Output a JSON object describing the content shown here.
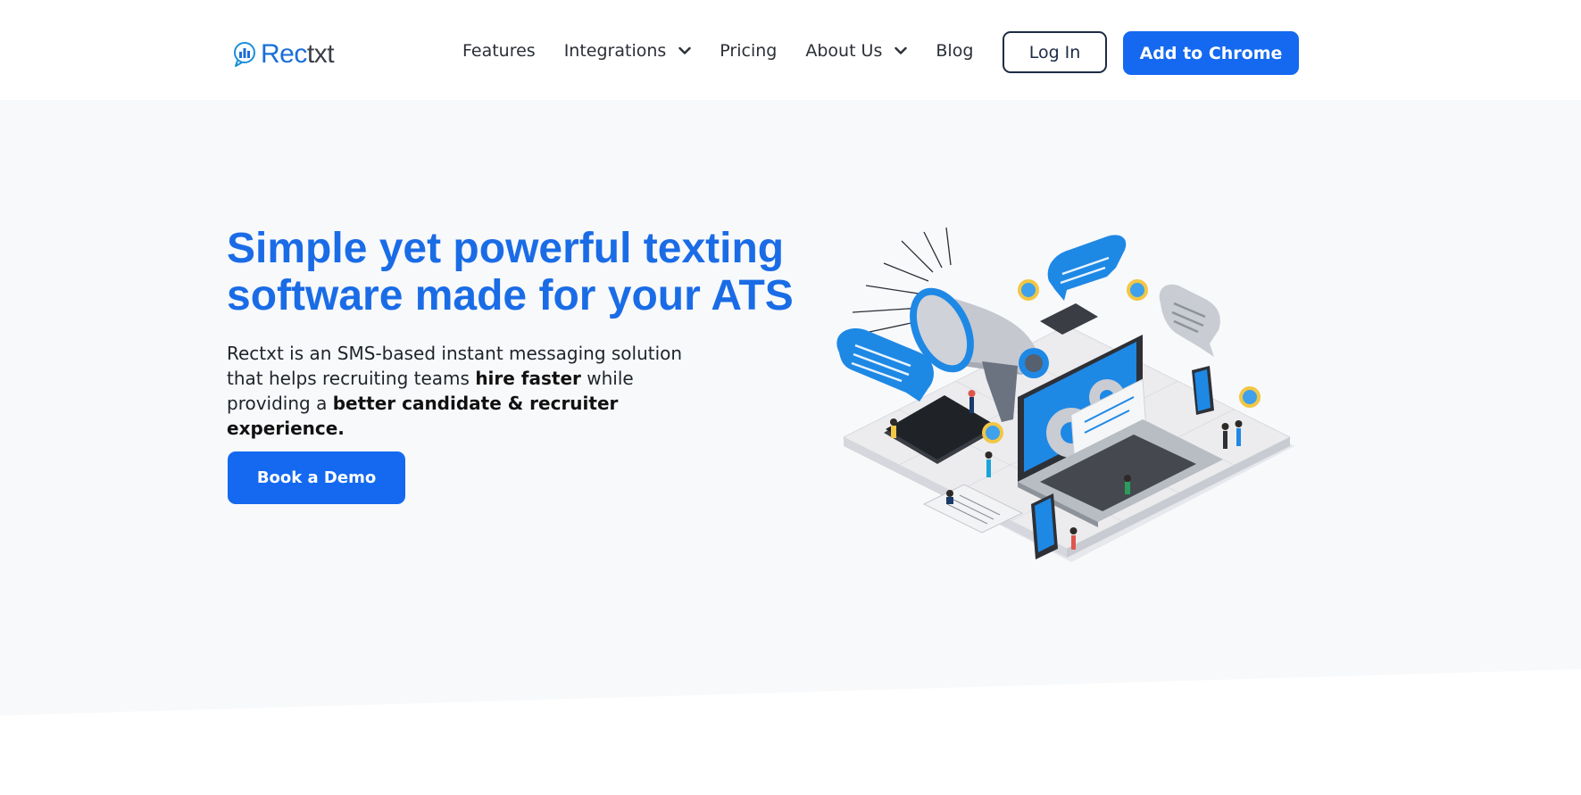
{
  "nav": {
    "logo": {
      "rec": "Rec",
      "txt": "txt"
    },
    "menu": [
      {
        "label": "Features",
        "dropdown": false
      },
      {
        "label": "Integrations",
        "dropdown": true
      },
      {
        "label": "Pricing",
        "dropdown": false
      },
      {
        "label": "About Us",
        "dropdown": true
      },
      {
        "label": "Blog",
        "dropdown": false
      }
    ],
    "login_label": "Log In",
    "chrome_label": "Add to Chrome"
  },
  "hero": {
    "title_line1": "Simple yet powerful texting",
    "title_line2": "software made for your ATS",
    "desc": {
      "part1": "Rectxt is an SMS-based instant messaging solution that helps recruiting teams ",
      "bold1": "hire faster",
      "part2": " while providing a ",
      "bold2": "better candidate & recruiter experience."
    },
    "demo_label": "Book a Demo"
  },
  "colors": {
    "brand": "#1469f0",
    "title": "#1a6ce6",
    "hero_bg": "#f8f9fb",
    "nav_text": "#2b2f36"
  },
  "icons": [
    "rectxt-logo-icon",
    "chevron-down-icon",
    "megaphone-illustration"
  ]
}
